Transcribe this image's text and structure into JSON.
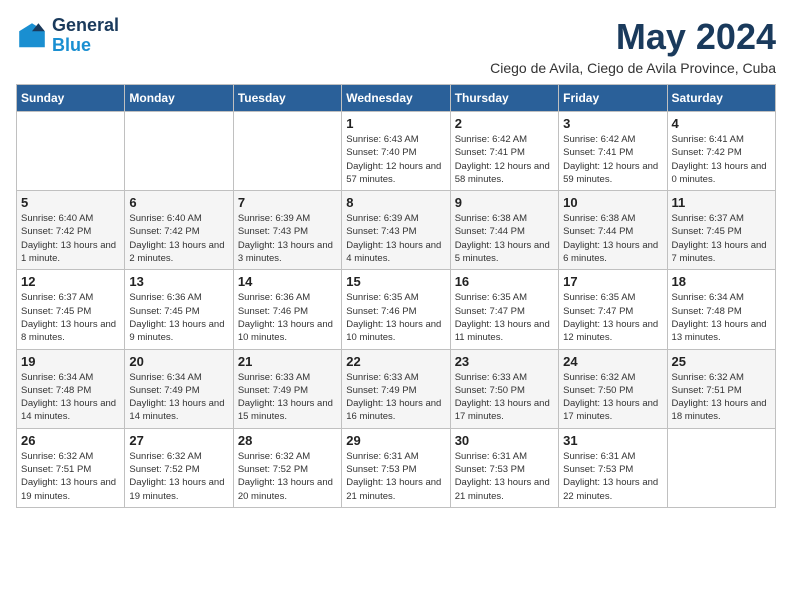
{
  "logo": {
    "text_general": "General",
    "text_blue": "Blue"
  },
  "header": {
    "month": "May 2024",
    "location": "Ciego de Avila, Ciego de Avila Province, Cuba"
  },
  "days_of_week": [
    "Sunday",
    "Monday",
    "Tuesday",
    "Wednesday",
    "Thursday",
    "Friday",
    "Saturday"
  ],
  "weeks": [
    [
      {
        "day": "",
        "info": ""
      },
      {
        "day": "",
        "info": ""
      },
      {
        "day": "",
        "info": ""
      },
      {
        "day": "1",
        "info": "Sunrise: 6:43 AM\nSunset: 7:40 PM\nDaylight: 12 hours\nand 57 minutes."
      },
      {
        "day": "2",
        "info": "Sunrise: 6:42 AM\nSunset: 7:41 PM\nDaylight: 12 hours\nand 58 minutes."
      },
      {
        "day": "3",
        "info": "Sunrise: 6:42 AM\nSunset: 7:41 PM\nDaylight: 12 hours\nand 59 minutes."
      },
      {
        "day": "4",
        "info": "Sunrise: 6:41 AM\nSunset: 7:42 PM\nDaylight: 13 hours\nand 0 minutes."
      }
    ],
    [
      {
        "day": "5",
        "info": "Sunrise: 6:40 AM\nSunset: 7:42 PM\nDaylight: 13 hours\nand 1 minute."
      },
      {
        "day": "6",
        "info": "Sunrise: 6:40 AM\nSunset: 7:42 PM\nDaylight: 13 hours\nand 2 minutes."
      },
      {
        "day": "7",
        "info": "Sunrise: 6:39 AM\nSunset: 7:43 PM\nDaylight: 13 hours\nand 3 minutes."
      },
      {
        "day": "8",
        "info": "Sunrise: 6:39 AM\nSunset: 7:43 PM\nDaylight: 13 hours\nand 4 minutes."
      },
      {
        "day": "9",
        "info": "Sunrise: 6:38 AM\nSunset: 7:44 PM\nDaylight: 13 hours\nand 5 minutes."
      },
      {
        "day": "10",
        "info": "Sunrise: 6:38 AM\nSunset: 7:44 PM\nDaylight: 13 hours\nand 6 minutes."
      },
      {
        "day": "11",
        "info": "Sunrise: 6:37 AM\nSunset: 7:45 PM\nDaylight: 13 hours\nand 7 minutes."
      }
    ],
    [
      {
        "day": "12",
        "info": "Sunrise: 6:37 AM\nSunset: 7:45 PM\nDaylight: 13 hours\nand 8 minutes."
      },
      {
        "day": "13",
        "info": "Sunrise: 6:36 AM\nSunset: 7:45 PM\nDaylight: 13 hours\nand 9 minutes."
      },
      {
        "day": "14",
        "info": "Sunrise: 6:36 AM\nSunset: 7:46 PM\nDaylight: 13 hours\nand 10 minutes."
      },
      {
        "day": "15",
        "info": "Sunrise: 6:35 AM\nSunset: 7:46 PM\nDaylight: 13 hours\nand 10 minutes."
      },
      {
        "day": "16",
        "info": "Sunrise: 6:35 AM\nSunset: 7:47 PM\nDaylight: 13 hours\nand 11 minutes."
      },
      {
        "day": "17",
        "info": "Sunrise: 6:35 AM\nSunset: 7:47 PM\nDaylight: 13 hours\nand 12 minutes."
      },
      {
        "day": "18",
        "info": "Sunrise: 6:34 AM\nSunset: 7:48 PM\nDaylight: 13 hours\nand 13 minutes."
      }
    ],
    [
      {
        "day": "19",
        "info": "Sunrise: 6:34 AM\nSunset: 7:48 PM\nDaylight: 13 hours\nand 14 minutes."
      },
      {
        "day": "20",
        "info": "Sunrise: 6:34 AM\nSunset: 7:49 PM\nDaylight: 13 hours\nand 14 minutes."
      },
      {
        "day": "21",
        "info": "Sunrise: 6:33 AM\nSunset: 7:49 PM\nDaylight: 13 hours\nand 15 minutes."
      },
      {
        "day": "22",
        "info": "Sunrise: 6:33 AM\nSunset: 7:49 PM\nDaylight: 13 hours\nand 16 minutes."
      },
      {
        "day": "23",
        "info": "Sunrise: 6:33 AM\nSunset: 7:50 PM\nDaylight: 13 hours\nand 17 minutes."
      },
      {
        "day": "24",
        "info": "Sunrise: 6:32 AM\nSunset: 7:50 PM\nDaylight: 13 hours\nand 17 minutes."
      },
      {
        "day": "25",
        "info": "Sunrise: 6:32 AM\nSunset: 7:51 PM\nDaylight: 13 hours\nand 18 minutes."
      }
    ],
    [
      {
        "day": "26",
        "info": "Sunrise: 6:32 AM\nSunset: 7:51 PM\nDaylight: 13 hours\nand 19 minutes."
      },
      {
        "day": "27",
        "info": "Sunrise: 6:32 AM\nSunset: 7:52 PM\nDaylight: 13 hours\nand 19 minutes."
      },
      {
        "day": "28",
        "info": "Sunrise: 6:32 AM\nSunset: 7:52 PM\nDaylight: 13 hours\nand 20 minutes."
      },
      {
        "day": "29",
        "info": "Sunrise: 6:31 AM\nSunset: 7:53 PM\nDaylight: 13 hours\nand 21 minutes."
      },
      {
        "day": "30",
        "info": "Sunrise: 6:31 AM\nSunset: 7:53 PM\nDaylight: 13 hours\nand 21 minutes."
      },
      {
        "day": "31",
        "info": "Sunrise: 6:31 AM\nSunset: 7:53 PM\nDaylight: 13 hours\nand 22 minutes."
      },
      {
        "day": "",
        "info": ""
      }
    ]
  ]
}
